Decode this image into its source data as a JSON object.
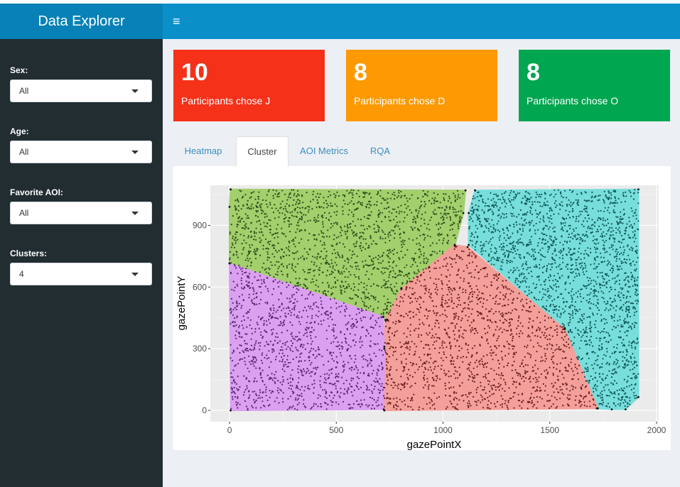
{
  "app": {
    "title": "Data Explorer",
    "menu_icon": "hamburger-icon",
    "menu_glyph": "≡"
  },
  "sidebar": {
    "controls": [
      {
        "label": "Sex:",
        "value": "All"
      },
      {
        "label": "Age:",
        "value": "All"
      },
      {
        "label": "Favorite AOI:",
        "value": "All"
      },
      {
        "label": "Clusters:",
        "value": "4"
      }
    ]
  },
  "value_boxes": [
    {
      "value": "10",
      "caption": "Participants chose J",
      "color": "#f5311a"
    },
    {
      "value": "8",
      "caption": "Participants chose D",
      "color": "#fd9903"
    },
    {
      "value": "8",
      "caption": "Participants chose O",
      "color": "#01a651"
    }
  ],
  "tabs": [
    {
      "label": "Heatmap",
      "active": false
    },
    {
      "label": "Cluster",
      "active": true
    },
    {
      "label": "AOI Metrics",
      "active": false
    },
    {
      "label": "RQA",
      "active": false
    }
  ],
  "chart_data": {
    "type": "scatter",
    "xlabel": "gazePointX",
    "ylabel": "gazePointY",
    "xlim": [
      -90,
      2010
    ],
    "ylim": [
      -55,
      1095
    ],
    "x_ticks": [
      0,
      500,
      1000,
      1500,
      2000
    ],
    "y_ticks": [
      0,
      300,
      600,
      900
    ],
    "grid": true,
    "clusters": [
      {
        "color": "#a3cf6c",
        "point_color": "#2e4d1a",
        "hull": [
          [
            5,
            1075
          ],
          [
            1105,
            1070
          ],
          [
            1095,
            960
          ],
          [
            1055,
            800
          ],
          [
            805,
            595
          ],
          [
            740,
            440
          ],
          [
            720,
            455
          ],
          [
            0,
            715
          ],
          [
            0,
            990
          ],
          [
            5,
            1075
          ]
        ],
        "n_points": 1400
      },
      {
        "color": "#78dedc",
        "point_color": "#0e5a5a",
        "hull": [
          [
            1150,
            1070
          ],
          [
            1915,
            1075
          ],
          [
            1915,
            65
          ],
          [
            1855,
            5
          ],
          [
            1790,
            5
          ],
          [
            1720,
            10
          ],
          [
            1570,
            400
          ],
          [
            1120,
            805
          ],
          [
            1120,
            960
          ],
          [
            1150,
            1070
          ]
        ],
        "n_points": 1900
      },
      {
        "color": "#f4a09a",
        "point_color": "#6e1e1e",
        "hull": [
          [
            1055,
            805
          ],
          [
            1115,
            795
          ],
          [
            1570,
            395
          ],
          [
            1725,
            10
          ],
          [
            725,
            0
          ],
          [
            725,
            310
          ],
          [
            730,
            440
          ],
          [
            805,
            590
          ],
          [
            1055,
            805
          ]
        ],
        "n_points": 1400
      },
      {
        "color": "#dba0f0",
        "point_color": "#5a2575",
        "hull": [
          [
            0,
            715
          ],
          [
            720,
            455
          ],
          [
            725,
            300
          ],
          [
            722,
            5
          ],
          [
            5,
            0
          ],
          [
            0,
            715
          ]
        ],
        "n_points": 1100
      }
    ]
  }
}
